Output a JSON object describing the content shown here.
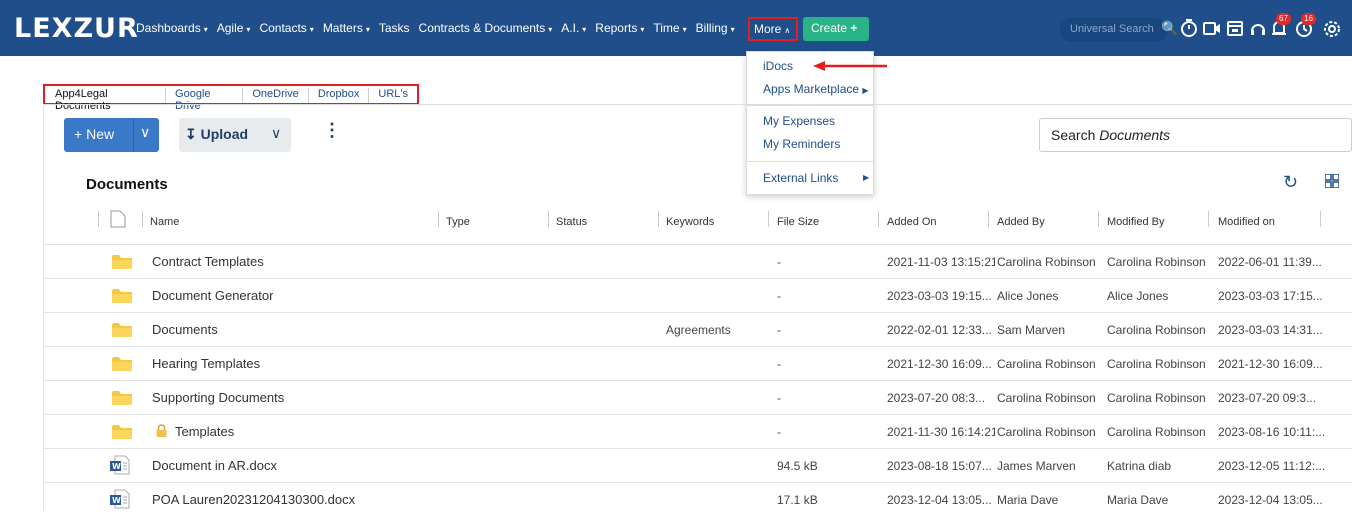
{
  "app": {
    "logo": "LEXZUR"
  },
  "nav": {
    "items": [
      {
        "label": "Dashboards",
        "caret": true
      },
      {
        "label": "Agile",
        "caret": true
      },
      {
        "label": "Contacts",
        "caret": true
      },
      {
        "label": "Matters",
        "caret": true
      },
      {
        "label": "Tasks",
        "caret": false
      },
      {
        "label": "Contracts & Documents",
        "caret": true
      },
      {
        "label": "A.I.",
        "caret": true
      },
      {
        "label": "Reports",
        "caret": true
      },
      {
        "label": "Time",
        "caret": true
      },
      {
        "label": "Billing",
        "caret": true
      }
    ],
    "more_label": "More",
    "create_label": "Create",
    "search_placeholder": "Universal Search",
    "notifications_count": "67",
    "reminders_count": "16"
  },
  "more_menu": {
    "items": [
      "iDocs",
      "Apps Marketplace",
      "My Expenses",
      "My Reminders",
      "External Links"
    ]
  },
  "tabs": [
    "App4Legal Documents",
    "Google Drive",
    "OneDrive",
    "Dropbox",
    "URL's"
  ],
  "toolbar": {
    "new_label": "New",
    "upload_label": "Upload",
    "search_prefix": "Search ",
    "search_emph": "Documents"
  },
  "documents": {
    "title": "Documents",
    "columns": [
      "Name",
      "Type",
      "Status",
      "Keywords",
      "File Size",
      "Added On",
      "Added By",
      "Modified By",
      "Modified on"
    ],
    "rows": [
      {
        "kind": "folder",
        "name": "Contract Templates",
        "keywords": "",
        "size": "-",
        "added_on": "2021-11-03 13:15:21",
        "added_by": "Carolina Robinson",
        "modified_by": "Carolina Robinson",
        "modified_on": "2022-06-01 11:39..."
      },
      {
        "kind": "folder",
        "name": "Document Generator",
        "keywords": "",
        "size": "-",
        "added_on": "2023-03-03 19:15...",
        "added_by": "Alice Jones",
        "modified_by": "Alice Jones",
        "modified_on": "2023-03-03 17:15..."
      },
      {
        "kind": "folder",
        "name": "Documents",
        "keywords": "Agreements",
        "size": "-",
        "added_on": "2022-02-01 12:33...",
        "added_by": "Sam Marven",
        "modified_by": "Carolina Robinson",
        "modified_on": "2023-03-03 14:31..."
      },
      {
        "kind": "folder",
        "name": "Hearing Templates",
        "keywords": "",
        "size": "-",
        "added_on": "2021-12-30 16:09...",
        "added_by": "Carolina Robinson",
        "modified_by": "Carolina Robinson",
        "modified_on": "2021-12-30 16:09..."
      },
      {
        "kind": "folder",
        "name": "Supporting Documents",
        "keywords": "",
        "size": "-",
        "added_on": "2023-07-20 08:3...",
        "added_by": "Carolina Robinson",
        "modified_by": "Carolina Robinson",
        "modified_on": "2023-07-20 09:3..."
      },
      {
        "kind": "folder-locked",
        "name": "Templates",
        "keywords": "",
        "size": "-",
        "added_on": "2021-11-30 16:14:21",
        "added_by": "Carolina Robinson",
        "modified_by": "Carolina Robinson",
        "modified_on": "2023-08-16 10:11:..."
      },
      {
        "kind": "word",
        "name": "Document in AR.docx",
        "keywords": "",
        "size": "94.5 kB",
        "added_on": "2023-08-18 15:07...",
        "added_by": "James Marven",
        "modified_by": "Katrina diab",
        "modified_on": "2023-12-05 11:12:..."
      },
      {
        "kind": "word",
        "name": "POA Lauren20231204130300.docx",
        "keywords": "",
        "size": "17.1 kB",
        "added_on": "2023-12-04 13:05...",
        "added_by": "Maria Dave",
        "modified_by": "Maria Dave",
        "modified_on": "2023-12-04 13:05..."
      }
    ]
  },
  "colors": {
    "navbar": "#1f4e8a",
    "create": "#28b487",
    "highlight": "#e02020",
    "primary_button": "#3a79c8"
  }
}
